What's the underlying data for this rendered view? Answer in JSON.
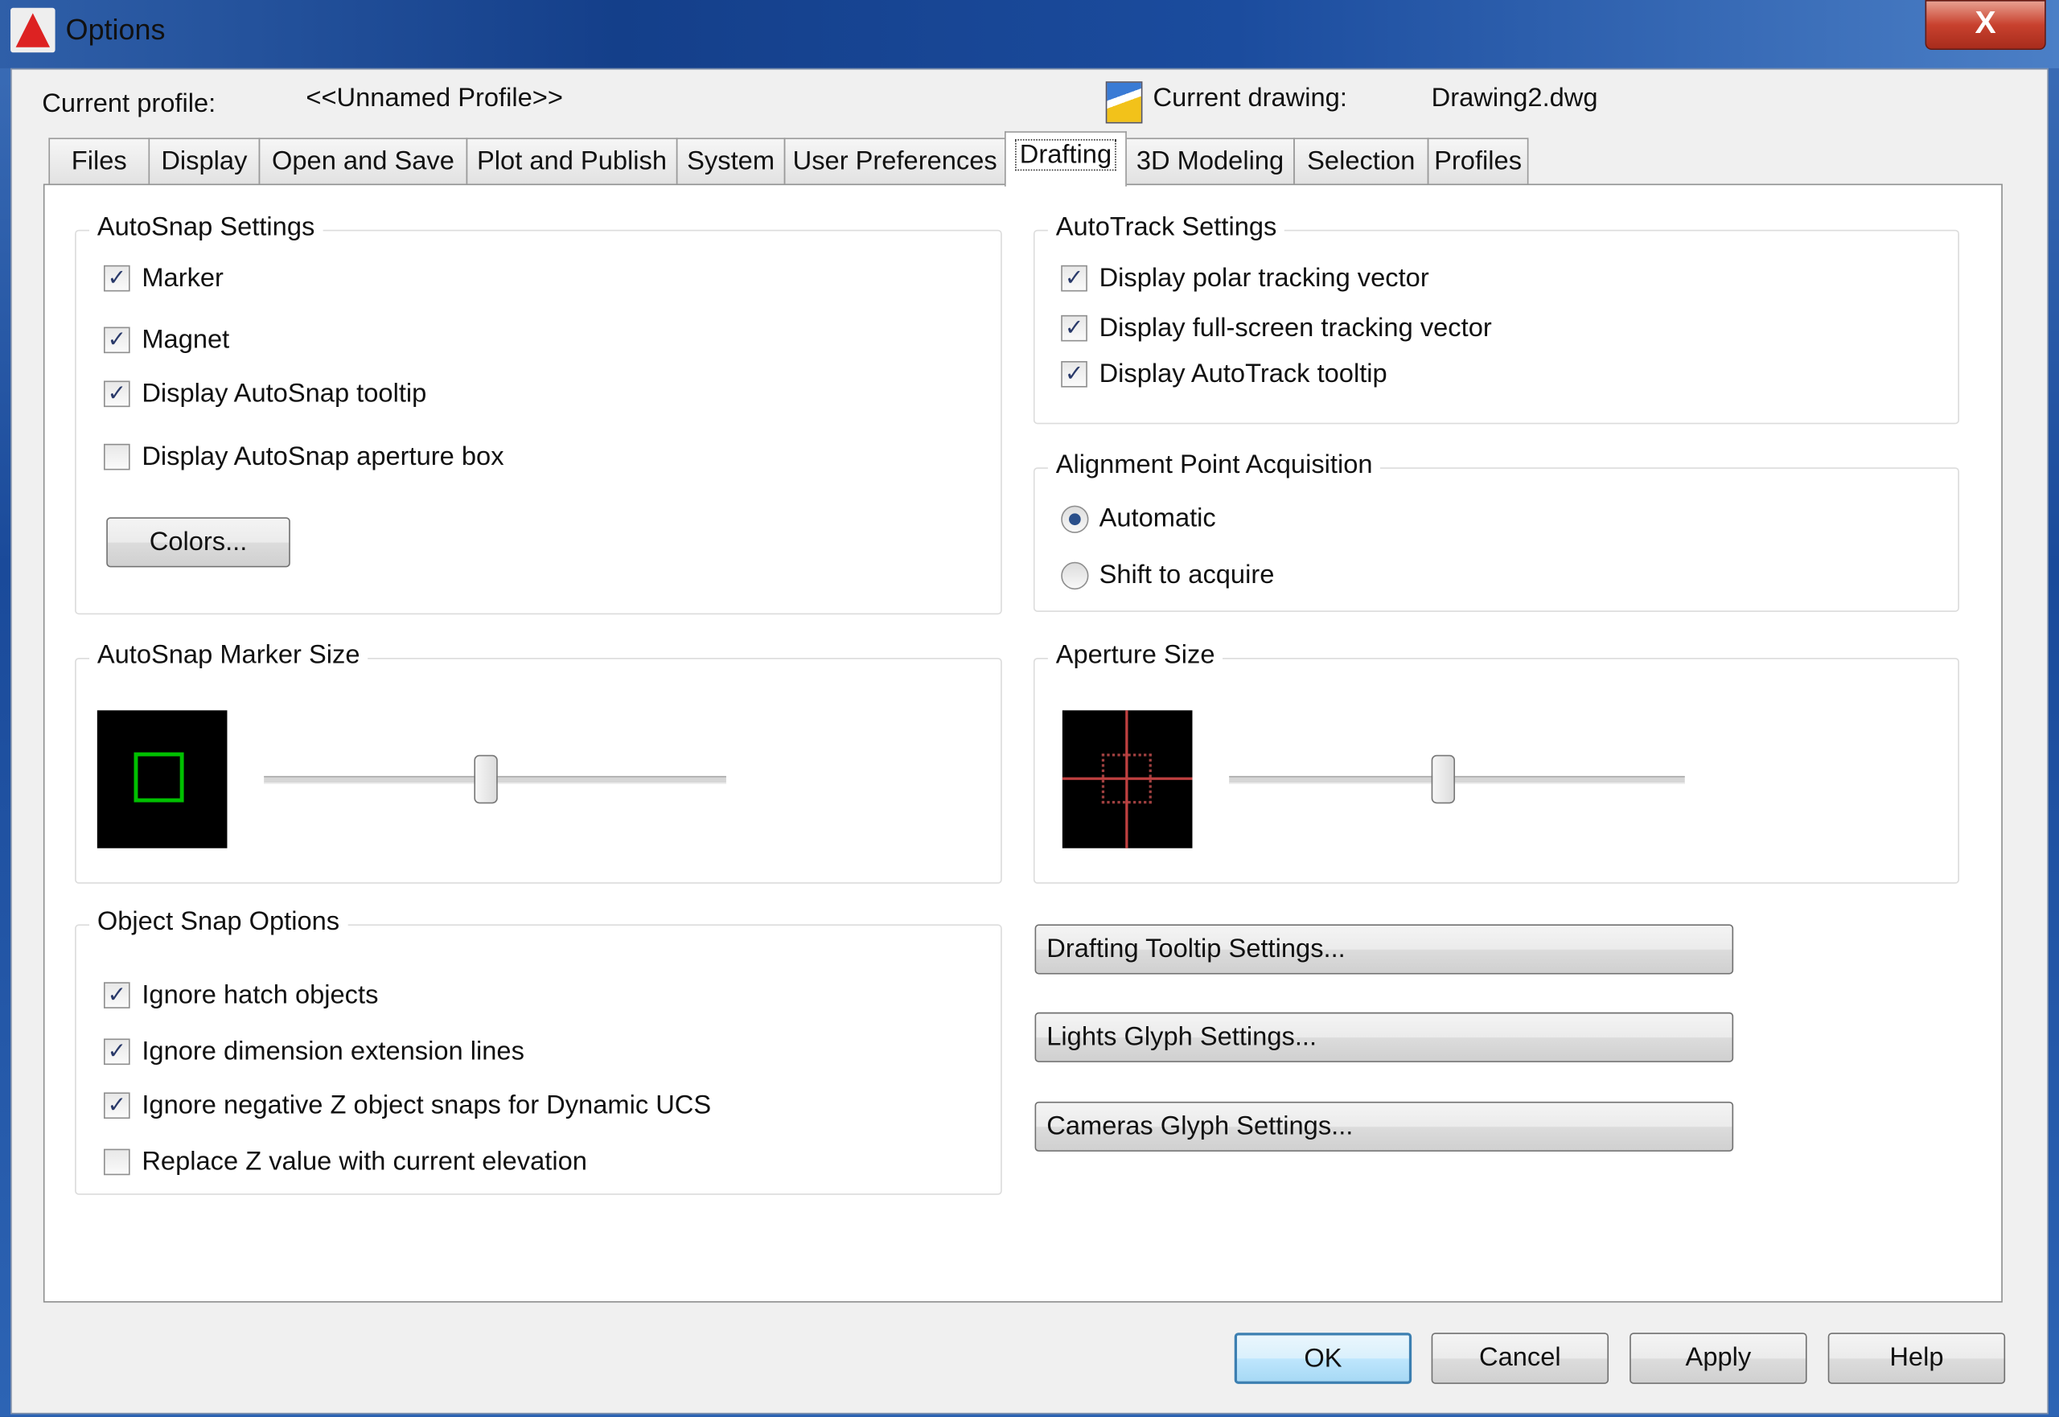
{
  "window": {
    "title": "Options",
    "close_label": "X",
    "app_icon": "autocad-logo-icon"
  },
  "header": {
    "profile_label": "Current profile:",
    "profile_value": "<<Unnamed Profile>>",
    "drawing_label": "Current drawing:",
    "drawing_value": "Drawing2.dwg",
    "drawing_icon": "drawing-file-icon"
  },
  "tabs": [
    {
      "label": "Files"
    },
    {
      "label": "Display"
    },
    {
      "label": "Open and Save"
    },
    {
      "label": "Plot and Publish"
    },
    {
      "label": "System"
    },
    {
      "label": "User Preferences"
    },
    {
      "label": "Drafting",
      "selected": true
    },
    {
      "label": "3D Modeling"
    },
    {
      "label": "Selection"
    },
    {
      "label": "Profiles"
    }
  ],
  "autosnap": {
    "title": "AutoSnap Settings",
    "items": [
      {
        "label": "Marker",
        "checked": true
      },
      {
        "label": "Magnet",
        "checked": true
      },
      {
        "label": "Display AutoSnap tooltip",
        "checked": true
      },
      {
        "label": "Display AutoSnap aperture box",
        "checked": false
      }
    ],
    "colors_button": "Colors..."
  },
  "autotrack": {
    "title": "AutoTrack Settings",
    "items": [
      {
        "label": "Display polar tracking vector",
        "checked": true
      },
      {
        "label": "Display full-screen tracking vector",
        "checked": true
      },
      {
        "label": "Display AutoTrack tooltip",
        "checked": true
      }
    ]
  },
  "alignment": {
    "title": "Alignment Point Acquisition",
    "options": [
      {
        "label": "Automatic",
        "selected": true
      },
      {
        "label": "Shift to acquire",
        "selected": false
      }
    ]
  },
  "marker_size": {
    "title": "AutoSnap Marker Size",
    "value_fraction": 0.48,
    "marker_color": "#00c000"
  },
  "aperture_size": {
    "title": "Aperture Size",
    "value_fraction": 0.47,
    "crosshair_color": "#c04040"
  },
  "object_snap": {
    "title": "Object Snap Options",
    "items": [
      {
        "label": "Ignore hatch objects",
        "checked": true
      },
      {
        "label": "Ignore dimension extension lines",
        "checked": true
      },
      {
        "label": "Ignore negative Z object snaps for Dynamic UCS",
        "checked": true
      },
      {
        "label": "Replace Z value with current elevation",
        "checked": false
      }
    ]
  },
  "side_buttons": {
    "tooltip": "Drafting Tooltip Settings...",
    "lights": "Lights Glyph Settings...",
    "cameras": "Cameras Glyph Settings..."
  },
  "footer": {
    "ok": "OK",
    "cancel": "Cancel",
    "apply": "Apply",
    "help": "Help"
  },
  "check_glyph": "✓"
}
